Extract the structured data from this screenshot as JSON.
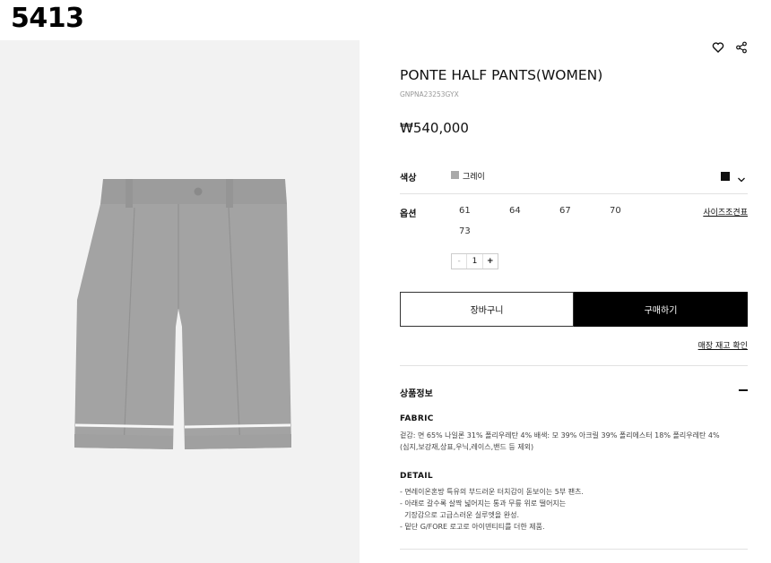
{
  "corner_id": "5413",
  "icons": {
    "wishlist": "heart-icon",
    "share": "share-icon",
    "dropdown": "chevron-down-icon",
    "collapse": "minus-icon"
  },
  "product": {
    "title": "PONTE HALF PANTS(WOMEN)",
    "code": "GNPNA23253GYX",
    "price": "₩540,000"
  },
  "color": {
    "label": "색상",
    "selected_name": "그레이",
    "swatch_color": "#a9a9a9",
    "alt_swatch_color": "#111111"
  },
  "option": {
    "label": "옵션",
    "sizes": [
      "61",
      "64",
      "67",
      "70",
      "73"
    ],
    "size_guide": "사이즈조견표"
  },
  "quantity": {
    "minus": "-",
    "value": "1",
    "plus": "+"
  },
  "buttons": {
    "cart": "장바구니",
    "buy": "구매하기"
  },
  "store_stock": "매장 재고 확인",
  "info": {
    "heading": "상품정보",
    "fabric_title": "FABRIC",
    "fabric_text": "겉감: 면 65% 나일론 31% 폴리우레탄 4% 배색: 모 39% 아크릴 39% 폴리에스터 18% 폴리우레탄 4%\n(심지,보강재,상표,우닉,레이스,밴드 등 제외)",
    "detail_title": "DETAIL",
    "detail_text": "- 면레이온혼방 특유의 부드러운 터치감이 돋보이는 5부 팬츠.\n- 아래로 갈수록 살짝 넓어지는 통과 무릎 위로 떨어지는\n  기장감으로 고급스러운 실루엣을 완성.\n- 밑단 G/FORE 로고로 아이덴티티를 더한 제품."
  }
}
